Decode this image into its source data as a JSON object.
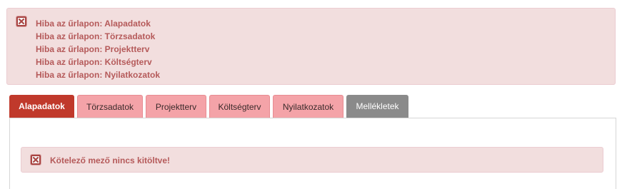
{
  "error_summary": {
    "icon": "error-x-icon",
    "messages": [
      "Hiba az űrlapon: Alapadatok",
      "Hiba az űrlapon: Törzsadatok",
      "Hiba az űrlapon: Projektterv",
      "Hiba az űrlapon: Költségterv",
      "Hiba az űrlapon: Nyilatkozatok"
    ]
  },
  "tabs": [
    {
      "label": "Alapadatok",
      "state": "active"
    },
    {
      "label": "Törzsadatok",
      "state": "error"
    },
    {
      "label": "Projektterv",
      "state": "error"
    },
    {
      "label": "Költségterv",
      "state": "error"
    },
    {
      "label": "Nyilatkozatok",
      "state": "error"
    },
    {
      "label": "Mellékletek",
      "state": "neutral"
    }
  ],
  "field_alert": {
    "icon": "error-x-icon",
    "text": "Kötelező mező nincs kitöltve!"
  },
  "colors": {
    "active_tab": "#c0392b",
    "error_tab": "#f4a3a8",
    "neutral_tab": "#8a8a8a",
    "alert_bg": "#f2dede",
    "alert_text": "#b55a5a"
  }
}
